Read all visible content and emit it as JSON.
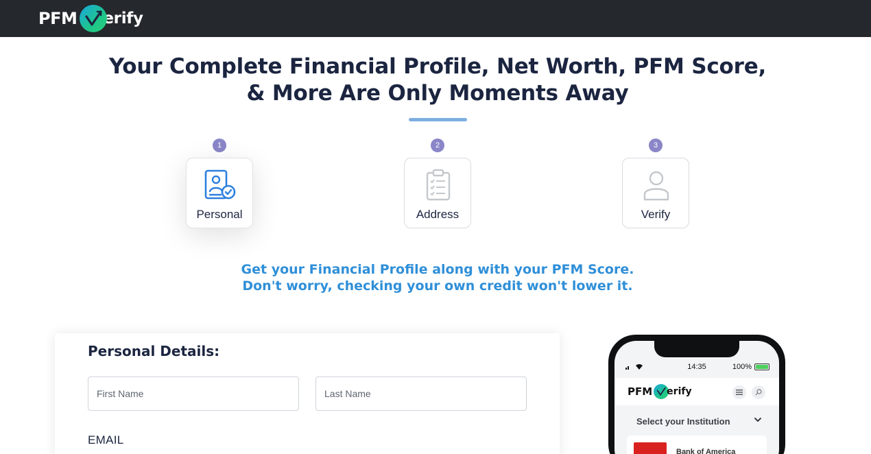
{
  "brand": {
    "logo_pfm": "PFM",
    "logo_verify": "erify"
  },
  "hero": {
    "title_line1": "Your Complete Financial Profile, Net Worth, PFM Score,",
    "title_line2": "& More Are Only Moments Away"
  },
  "steps": [
    {
      "number": "1",
      "label": "Personal",
      "icon": "personal-id-icon",
      "active": true
    },
    {
      "number": "2",
      "label": "Address",
      "icon": "clipboard-icon",
      "active": false
    },
    {
      "number": "3",
      "label": "Verify",
      "icon": "user-icon",
      "active": false
    }
  ],
  "subtitle": {
    "line1": "Get your Financial Profile along with your PFM Score.",
    "line2": "Don't worry, checking your own credit won't lower it."
  },
  "form": {
    "heading": "Personal Details:",
    "first_name_placeholder": "First Name",
    "last_name_placeholder": "Last Name",
    "email_label": "EMAIL"
  },
  "phone": {
    "time": "14:35",
    "battery": "100%",
    "logo_pfm": "PFM",
    "logo_verify": "erify",
    "select_label": "Select your Institution",
    "institution_name": "Bank of America"
  },
  "colors": {
    "topbar": "#25282d",
    "accent_blue": "#2f8fd8",
    "step_badge": "#8a86c8",
    "active_icon": "#2d7fe0"
  }
}
